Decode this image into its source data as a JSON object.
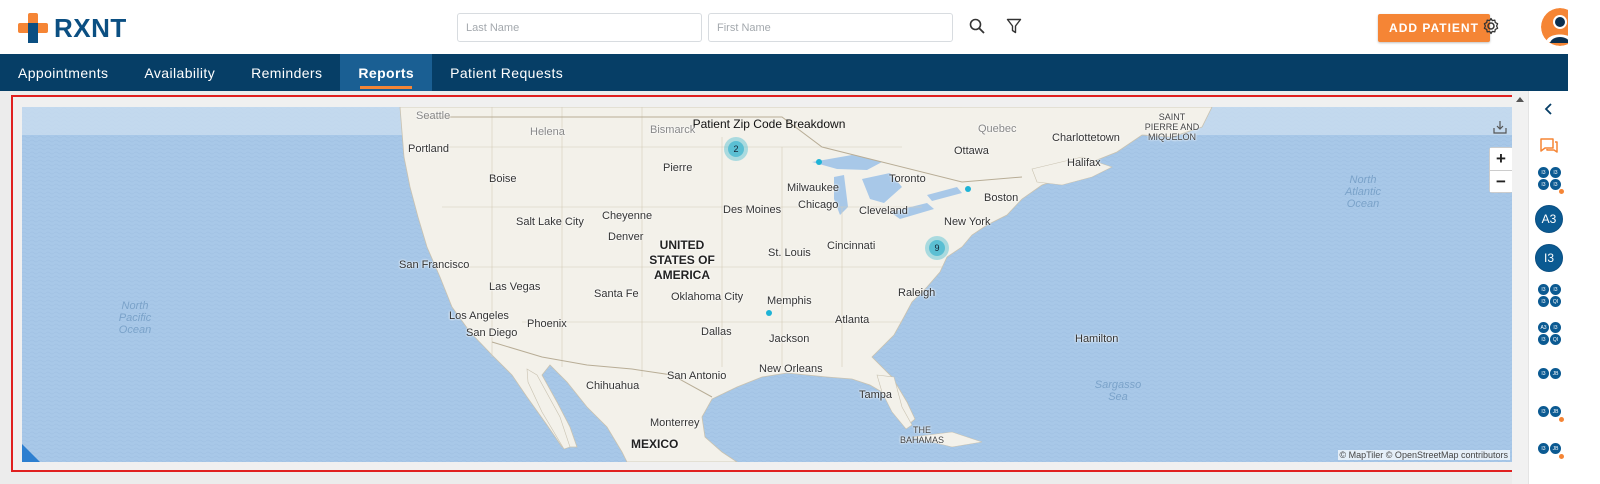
{
  "app": {
    "logo_text": "RXNT"
  },
  "header": {
    "last_name_placeholder": "Last Name",
    "first_name_placeholder": "First Name",
    "add_patient_label": "ADD PATIENT"
  },
  "nav": {
    "tabs": [
      {
        "label": "Appointments",
        "active": false
      },
      {
        "label": "Availability",
        "active": false
      },
      {
        "label": "Reminders",
        "active": false
      },
      {
        "label": "Reports",
        "active": true
      },
      {
        "label": "Patient Requests",
        "active": false
      }
    ]
  },
  "map": {
    "title": "Patient Zip Code Breakdown",
    "attribution": "© MapTiler © OpenStreetMap contributors",
    "zoom_in": "+",
    "zoom_out": "−",
    "labels": {
      "seattle": "Seattle",
      "helena": "Helena",
      "bismarck": "Bismarck",
      "portland": "Portland",
      "boise": "Boise",
      "pierre": "Pierre",
      "quebec": "Quebec",
      "charlottetown": "Charlottetown",
      "saint_pierre": "SAINT PIERRE AND MIQUELON",
      "ottawa": "Ottawa",
      "halifax": "Halifax",
      "milwaukee": "Milwaukee",
      "toronto": "Toronto",
      "boston": "Boston",
      "chicago": "Chicago",
      "des_moines": "Des Moines",
      "cleveland": "Cleveland",
      "new_york": "New York",
      "salt_lake_city": "Salt Lake City",
      "cheyenne": "Cheyenne",
      "denver": "Denver",
      "usa": "UNITED STATES OF AMERICA",
      "st_louis": "St. Louis",
      "cincinnati": "Cincinnati",
      "san_francisco": "San Francisco",
      "las_vegas": "Las Vegas",
      "santa_fe": "Santa Fe",
      "oklahoma_city": "Oklahoma City",
      "memphis": "Memphis",
      "raleigh": "Raleigh",
      "north_pacific": "North Pacific Ocean",
      "north_atlantic": "North Atlantic Ocean",
      "los_angeles": "Los Angeles",
      "san_diego": "San Diego",
      "phoenix": "Phoenix",
      "dallas": "Dallas",
      "atlanta": "Atlanta",
      "jackson": "Jackson",
      "hamilton": "Hamilton",
      "new_orleans": "New Orleans",
      "san_antonio": "San Antonio",
      "chihuahua": "Chihuahua",
      "sargasso": "Sargasso Sea",
      "tampa": "Tampa",
      "monterrey": "Monterrey",
      "the_bahamas": "THE BAHAMAS",
      "mexico": "MEXICO"
    },
    "clusters": [
      {
        "name": "north-central",
        "count": "2"
      },
      {
        "name": "mid-atlantic",
        "count": "9"
      }
    ],
    "points": [
      "wisconsin",
      "pennsylvania",
      "mississippi"
    ]
  },
  "sidebar": {
    "large_badges": [
      "A3",
      "I3"
    ],
    "mini_groups": [
      [
        "I3",
        "I3",
        "I3",
        "I3"
      ],
      [
        "I3",
        "I3",
        "I3",
        "QI"
      ],
      [
        "A3",
        "I3",
        "I3",
        "QI"
      ],
      [
        "I3",
        "JB"
      ],
      [
        "I3",
        "JB"
      ],
      [
        "I3",
        "JB"
      ]
    ]
  },
  "colors": {
    "brand_blue": "#0b4f82",
    "nav_bg": "#063e66",
    "nav_active": "#1a5f93",
    "accent_orange": "#f58535",
    "highlight_border": "#e02020",
    "ocean": "#a8c8e8",
    "land": "#f3f1ea",
    "cluster": "#5bbfd3"
  },
  "icons": {
    "logo": "plus-cross-icon",
    "search": "search-icon",
    "filter": "filter-icon",
    "settings": "gear-icon",
    "user": "user-avatar-icon",
    "collapse": "chevron-left-icon",
    "chat": "chat-icon",
    "download": "download-icon"
  }
}
